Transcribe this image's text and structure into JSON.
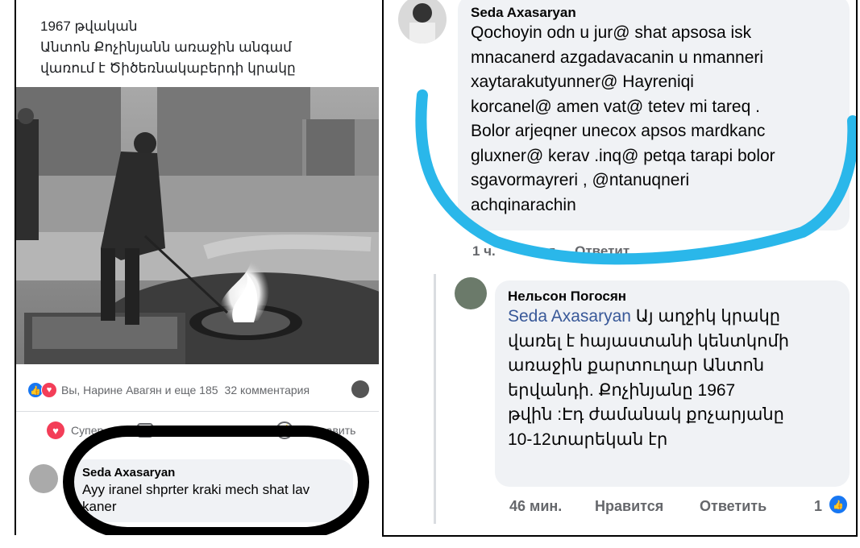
{
  "left_post": {
    "text_lines": [
      "1967 թվական",
      "Անտոն Քոչինյանն առաջին անգամ",
      "վառում է Ծիծեռնակաբերդի կրակը"
    ],
    "reactions_text": "Вы, Нарине Авагян и еще 185",
    "comments_count": "32 комментария",
    "actions": {
      "react": "Супер",
      "comment": "Комментировать",
      "send": "Отправить"
    },
    "comment": {
      "author": "Seda Axasaryan",
      "text_lines": [
        "Ayy  iranel shprter kraki mech shat lav",
        "kaner"
      ]
    }
  },
  "right_thread": {
    "comment1": {
      "author": "Seda Axasaryan",
      "text_lines": [
        "Qochoyin odn u jur@ shat apsosa  isk",
        "mnacanerd    azgadavacanin u nmanneri",
        "xaytarakutyunner@   Hayreniqi",
        "korcanel@  amen vat@ tetev mi tareq .",
        "Bolor  arjeqner  unecox apsos mardkanc",
        "gluxner@ kerav  .inq@ petqa  tarapi bolor",
        "sgavormayreri , @ntanuqneri",
        "achqinarachin"
      ],
      "meta_partial": "1 ч.          тся     Ответит"
    },
    "reply": {
      "author": "Нельсон Погосян",
      "mention": "Seda Axasaryan",
      "first_line_rest": " Այ աղջիկ կրակը",
      "text_lines": [
        "վառել է հայաստանի կենտկոմի",
        "առաջին քարտուղար Անտոն",
        "երվանդի. Քոչինյանը 1967",
        "թվին :Էդ ժամանակ քոչարյանը",
        "10-12տարեկան էր"
      ],
      "time": "46 мин.",
      "like_label": "Нравится",
      "reply_label": "Ответить",
      "like_count": "1"
    }
  },
  "colors": {
    "facebook_blue": "#1877f2",
    "marker_cyan": "#2ab7ea",
    "comment_bg": "#f0f2f5"
  }
}
